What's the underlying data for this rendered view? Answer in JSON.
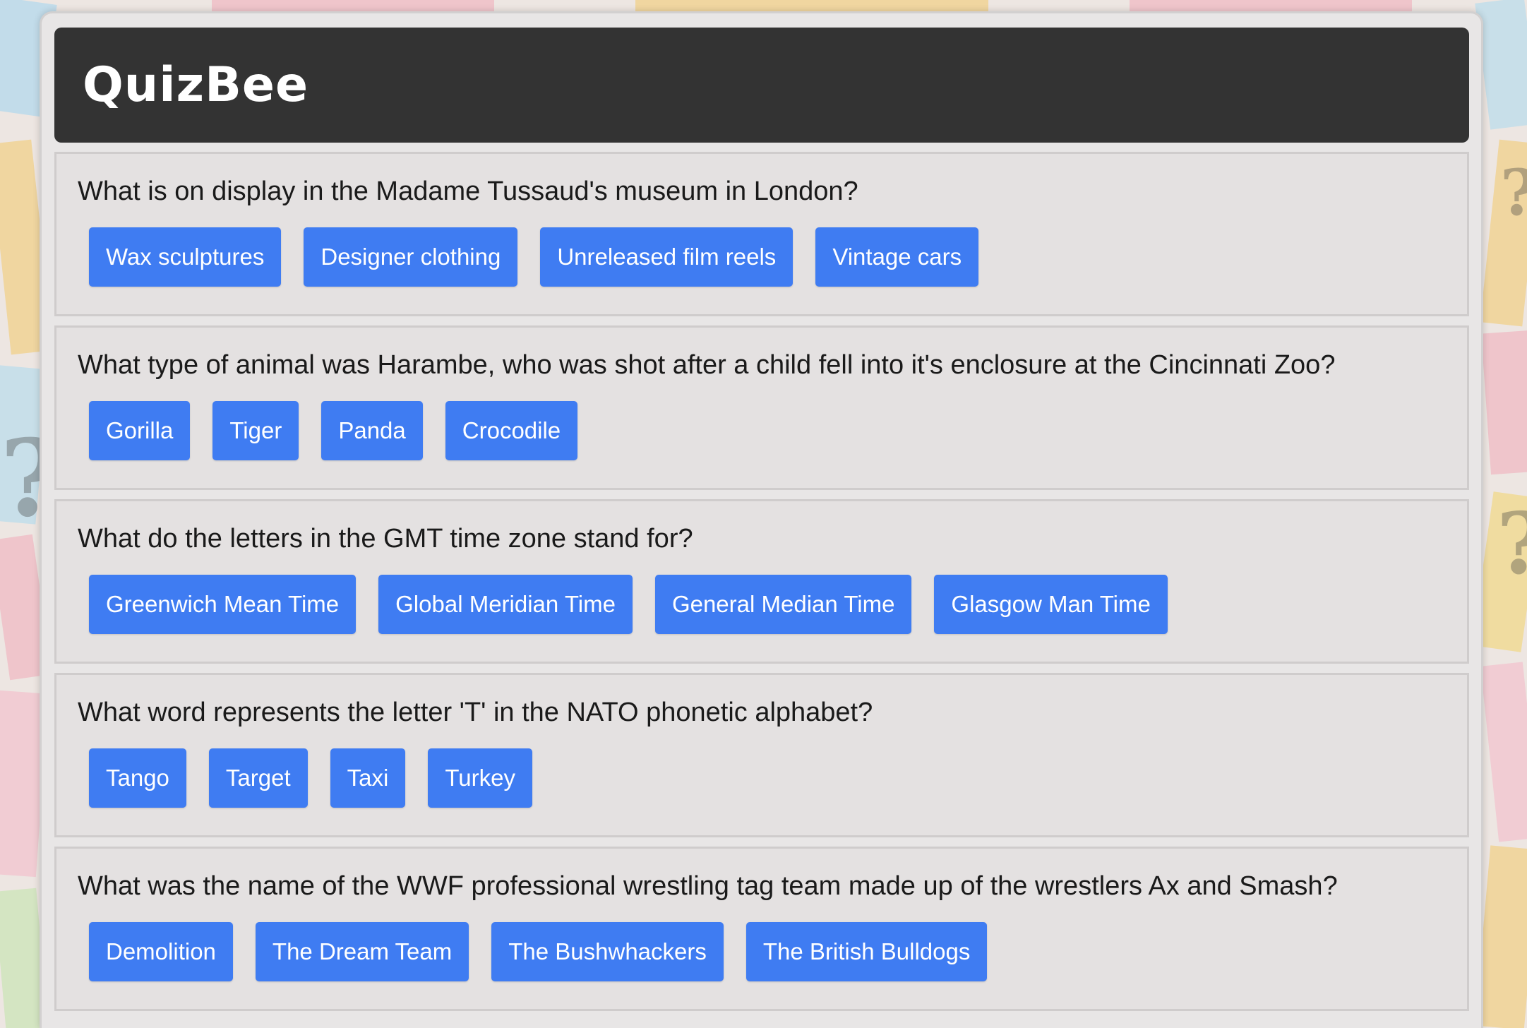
{
  "app": {
    "title": "QuizBee"
  },
  "colors": {
    "header_bg": "#333333",
    "card_bg": "#e4e1e1",
    "answer_button": "#3f7cf2",
    "answer_text": "#ffffff"
  },
  "questions": [
    {
      "text": "What is on display in the Madame Tussaud's museum in London?",
      "answers": [
        "Wax sculptures",
        "Designer clothing",
        "Unreleased film reels",
        "Vintage cars"
      ]
    },
    {
      "text": "What type of animal was Harambe, who was shot after a child fell into it's enclosure at the Cincinnati Zoo?",
      "answers": [
        "Gorilla",
        "Tiger",
        "Panda",
        "Crocodile"
      ]
    },
    {
      "text": "What do the letters in the GMT time zone stand for?",
      "answers": [
        "Greenwich Mean Time",
        "Global Meridian Time",
        "General Median Time",
        "Glasgow Man Time"
      ]
    },
    {
      "text": "What word represents the letter 'T' in the NATO phonetic alphabet?",
      "answers": [
        "Tango",
        "Target",
        "Taxi",
        "Turkey"
      ]
    },
    {
      "text": "What was the name of the WWF professional wrestling tag team made up of the wrestlers Ax and Smash?",
      "answers": [
        "Demolition",
        "The Dream Team",
        "The Bushwhackers",
        "The British Bulldogs"
      ]
    }
  ]
}
